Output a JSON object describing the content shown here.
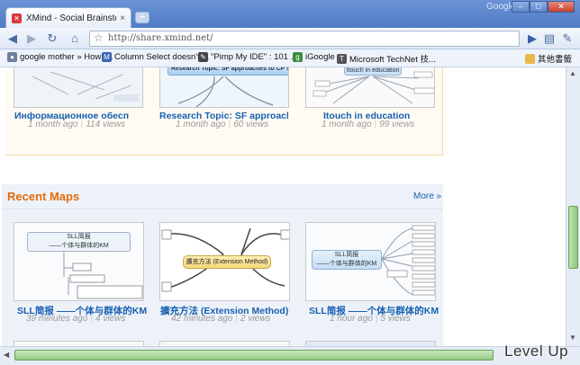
{
  "browser": {
    "tab_title": "XMind - Social Brainstormi...",
    "brand": "Google",
    "url": "http://share.xmind.net/",
    "bookmarks": [
      {
        "label": "google mother » How t...",
        "icon": "globe-icon",
        "color": "#6d7f9a"
      },
      {
        "label": "Column Select doesn't ...",
        "icon": "m-icon",
        "color": "#3a63b0"
      },
      {
        "label": "\"Pimp My IDE\" : 101 ...",
        "icon": "pin-icon",
        "color": "#444444"
      },
      {
        "label": "iGoogle",
        "icon": "igoogle-icon",
        "color": "#3b8d3b"
      },
      {
        "label": "Microsoft TechNet 技...",
        "icon": "technet-icon",
        "color": "#555555"
      }
    ],
    "other_bookmarks": "其他書籤"
  },
  "top_maps": [
    {
      "title": "Информационное обесп",
      "time": "1 month ago",
      "views": "114 views"
    },
    {
      "title": "Research Topic: SF approacl",
      "time": "1 month ago",
      "views": "60 views",
      "thumb_heading": "Research Topic: SF approaches to CP social"
    },
    {
      "title": "Itouch in education",
      "time": "1 month ago",
      "views": "99 views",
      "thumb_heading": "Itouch in education"
    }
  ],
  "recent": {
    "heading": "Recent Maps",
    "more": "More »",
    "maps": [
      {
        "title": "SLL简报 ——个体与群体的KM",
        "time": "39 minutes ago",
        "views": "4 views",
        "thumb_line1": "SLL简报",
        "thumb_line2": "——个体与群体的KM"
      },
      {
        "title": "擴充方法 (Extension Method)",
        "time": "42 minutes ago",
        "views": "2 views",
        "thumb_center": "擴充方法 (Extension Method)"
      },
      {
        "title": "SLL简报 ——个体与群体的KM",
        "time": "1 hour ago",
        "views": "5 views",
        "thumb_line1": "SLL简报",
        "thumb_line2": "——个体与群体的KM"
      }
    ]
  },
  "watermark": "Level Up",
  "colors": {
    "accent": "#e36c09",
    "link": "#1760b0"
  }
}
